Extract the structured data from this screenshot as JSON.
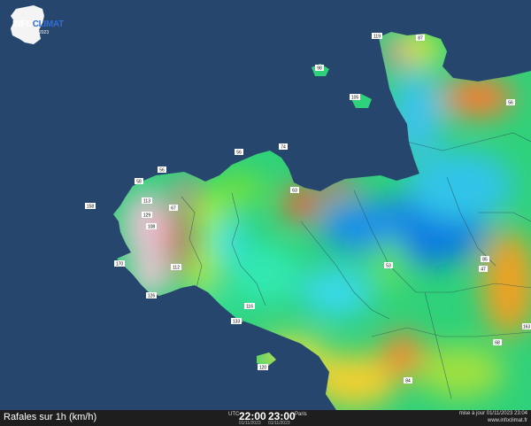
{
  "logo": {
    "part1": "INFO",
    "part2": "CLIMAT",
    "sub": "2023"
  },
  "footer": {
    "title": "Rafales sur 1h (km/h)",
    "utc_tag": "UTC",
    "utc_time": "22:00",
    "utc_date": "01/11/2023",
    "local_time": "23:00",
    "local_tag": "Paris",
    "local_date": "01/11/2023",
    "update": "mise à jour 01/11/2023 23:04",
    "site": "www.infoclimat.fr"
  },
  "colors": {
    "sea": "#27466e",
    "footer": "#1e1e1e"
  },
  "stations": [
    {
      "value": "119"
    },
    {
      "value": "87"
    },
    {
      "value": "98"
    },
    {
      "value": "105"
    },
    {
      "value": "56"
    },
    {
      "value": "56"
    },
    {
      "value": "74"
    },
    {
      "value": "56"
    },
    {
      "value": "58"
    },
    {
      "value": "113"
    },
    {
      "value": "158"
    },
    {
      "value": "67"
    },
    {
      "value": "129"
    },
    {
      "value": "108"
    },
    {
      "value": "63"
    },
    {
      "value": "170"
    },
    {
      "value": "112"
    },
    {
      "value": "126"
    },
    {
      "value": "116"
    },
    {
      "value": "133"
    },
    {
      "value": "53"
    },
    {
      "value": "85"
    },
    {
      "value": "47"
    },
    {
      "value": "163"
    },
    {
      "value": "68"
    },
    {
      "value": "120"
    },
    {
      "value": "84"
    }
  ]
}
